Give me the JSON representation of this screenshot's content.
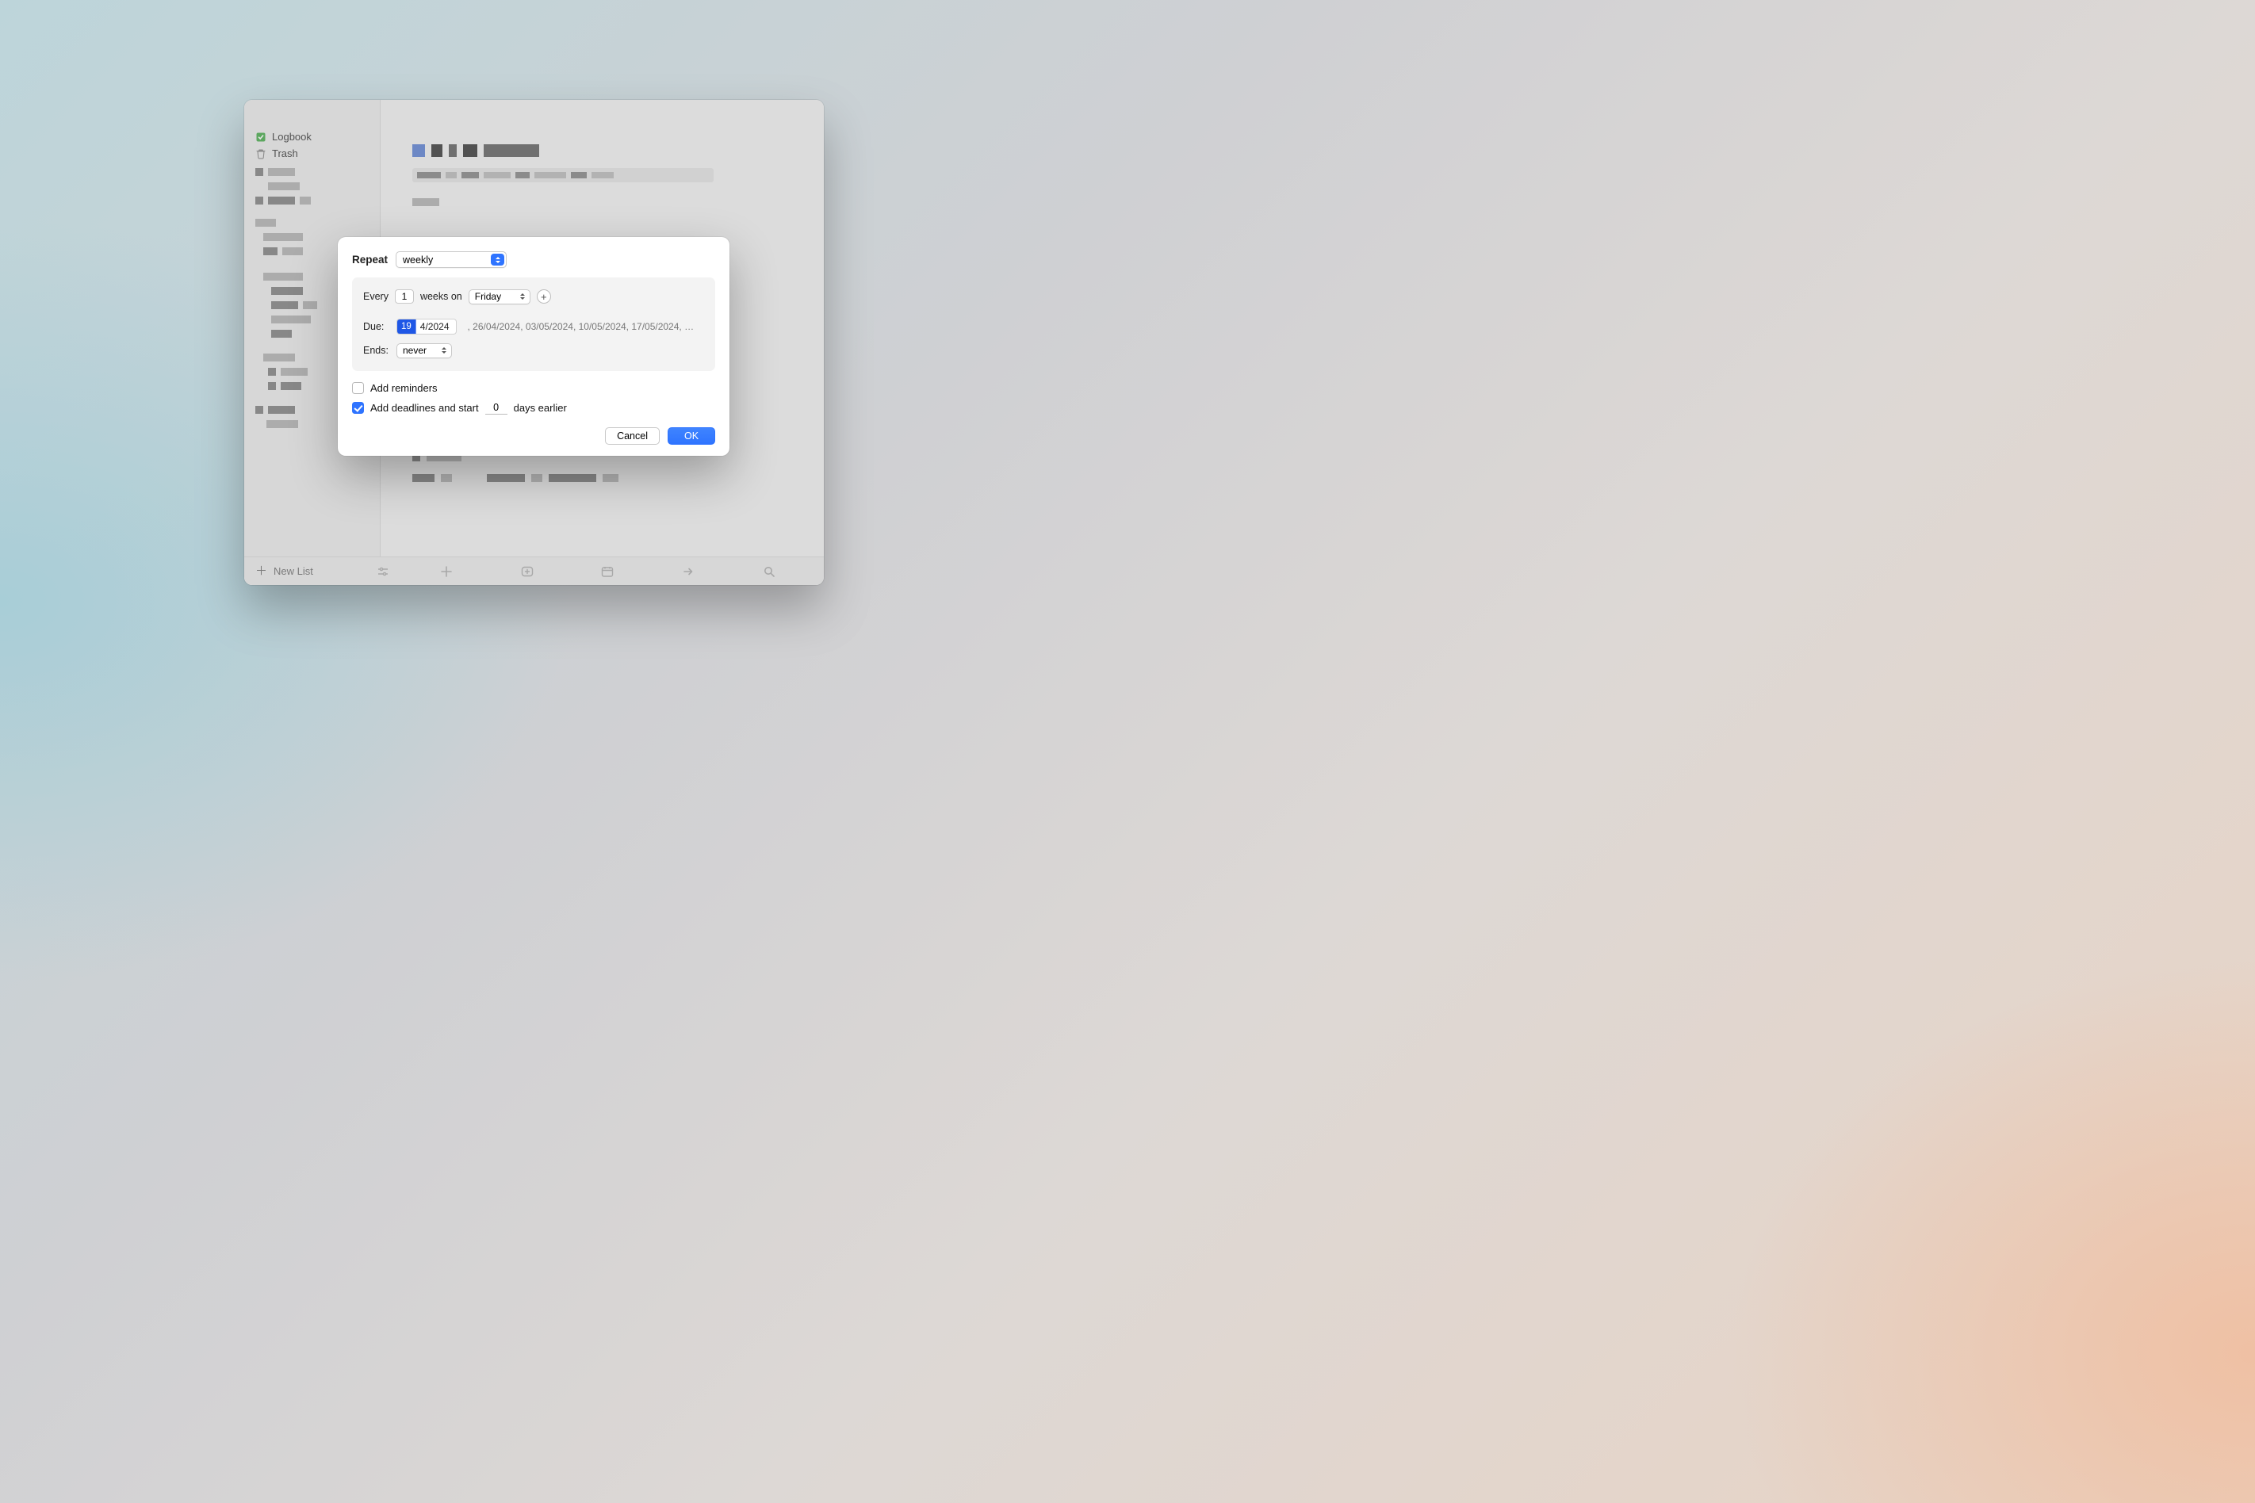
{
  "sidebar": {
    "logbook": "Logbook",
    "trash": "Trash"
  },
  "bottombar": {
    "new_list": "New List"
  },
  "modal": {
    "repeat_label": "Repeat",
    "repeat_value": "weekly",
    "every_label": "Every",
    "every_value": "1",
    "weeks_on_label": "weeks on",
    "day_value": "Friday",
    "due_label": "Due:",
    "due_day": "19",
    "due_rest": "4/2024",
    "next_dates": ",   26/04/2024,  03/05/2024,  10/05/2024,  17/05/2024, …",
    "ends_label": "Ends:",
    "ends_value": "never",
    "add_reminders_label": "Add reminders",
    "add_reminders_checked": false,
    "deadlines_prefix": "Add deadlines and start",
    "deadlines_value": "0",
    "deadlines_suffix": "days earlier",
    "deadlines_checked": true,
    "cancel": "Cancel",
    "ok": "OK"
  }
}
